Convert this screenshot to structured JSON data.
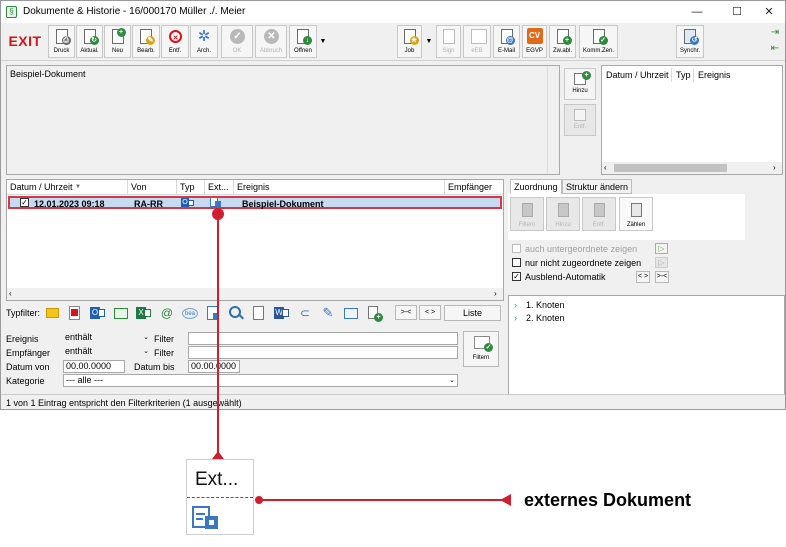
{
  "window": {
    "title": "Dokumente & Historie - 16/000170 Müller ./. Meier",
    "controls": {
      "minimize": "—",
      "maximize": "☐",
      "close": "✕"
    }
  },
  "toolbar": {
    "exit_label": "EXIT",
    "left_buttons": [
      {
        "label": "Druck",
        "icon": "print-doc-icon",
        "enabled": true
      },
      {
        "label": "Aktual.",
        "icon": "refresh-doc-icon",
        "enabled": true
      },
      {
        "label": "Neu",
        "icon": "new-doc-icon",
        "enabled": true
      },
      {
        "label": "Bearb.",
        "icon": "edit-doc-icon",
        "enabled": true
      },
      {
        "label": "Entf.",
        "icon": "delete-doc-icon",
        "enabled": true
      },
      {
        "label": "Arch.",
        "icon": "archive-icon",
        "enabled": true
      },
      {
        "label": "OK",
        "icon": "check-icon",
        "enabled": false
      },
      {
        "label": "Abbruch",
        "icon": "cancel-icon",
        "enabled": false
      },
      {
        "label": "Öffnen",
        "icon": "open-doc-icon",
        "enabled": true
      }
    ],
    "right_buttons": [
      {
        "label": "Job",
        "icon": "job-icon",
        "enabled": true
      },
      {
        "label": "Sign",
        "icon": "sign-icon",
        "enabled": false
      },
      {
        "label": "eEB",
        "icon": "eeb-icon",
        "enabled": false
      },
      {
        "label": "E-Mail",
        "icon": "email-icon",
        "enabled": true
      },
      {
        "label": "EGVP",
        "icon": "egvp-icon",
        "enabled": true
      },
      {
        "label": "Zw.abl.",
        "icon": "clipboard-icon",
        "enabled": true
      },
      {
        "label": "Komm.Zen.",
        "icon": "comm-center-icon",
        "enabled": true
      }
    ],
    "synchr_label": "Synchr."
  },
  "notes": {
    "text": "Beispiel-Dokument"
  },
  "history_side": {
    "hinzu_label": "Hinzu",
    "entf_label": "Entf.",
    "columns": [
      "Datum / Uhrzeit",
      "Typ",
      "Ereignis"
    ]
  },
  "grid": {
    "columns": [
      "Datum / Uhrzeit",
      "Von",
      "Typ",
      "Ext...",
      "Ereignis",
      "Empfänger"
    ],
    "sort_indicator": "▼",
    "rows": [
      {
        "checked": true,
        "datetime": "12.01.2023  09:18",
        "von": "RA-RR",
        "typ_icon": "outlook-type-icon",
        "ext_icon": "external-doc-icon",
        "ereignis": "Beispiel-Dokument",
        "empfaenger": ""
      }
    ]
  },
  "assignment": {
    "tabs": [
      "Zuordnung",
      "Struktur ändern"
    ],
    "buttons": [
      {
        "label": "Filtern",
        "enabled": false
      },
      {
        "label": "Hinzu",
        "enabled": false
      },
      {
        "label": "Entf.",
        "enabled": false
      },
      {
        "label": "Zählen",
        "enabled": true
      }
    ],
    "options": [
      {
        "label": "auch untergeordnete zeigen",
        "checked": false,
        "enabled": false
      },
      {
        "label": "nur nicht zugeordnete zeigen",
        "checked": false,
        "enabled": true
      },
      {
        "label": "Ausblend-Automatik",
        "checked": true,
        "enabled": true
      }
    ],
    "nav_labels": [
      "< >",
      ">-<"
    ]
  },
  "tree": {
    "items": [
      "1. Knoten",
      "2. Knoten"
    ],
    "expander": "›"
  },
  "typfilter": {
    "label": "Typfilter:",
    "icons": [
      "note-filter-icon",
      "pdf-filter-icon",
      "outlook-filter-icon",
      "folder-filter-icon",
      "excel-filter-icon",
      "at-filter-icon",
      "bea-filter-icon",
      "doc-filter-icon",
      "web-filter-icon",
      "text-filter-icon",
      "word-filter-icon",
      "attachment-filter-icon",
      "pen-filter-icon",
      "folder-open-filter-icon",
      "add-doc-filter-icon"
    ],
    "collapse_label": ">-<",
    "expand_label": "< >",
    "liste_label": "Liste"
  },
  "filter": {
    "ereignis_label": "Ereignis",
    "ereignis_mode": "enthält",
    "ereignis_filter_label": "Filter",
    "ereignis_value": "",
    "empfaenger_label": "Empfänger",
    "empfaenger_mode": "enthält",
    "empfaenger_filter_label": "Filter",
    "empfaenger_value": "",
    "datum_von_label": "Datum von",
    "datum_von_value": "00.00.0000",
    "datum_bis_label": "Datum bis",
    "datum_bis_value": "00.00.0000",
    "kategorie_label": "Kategorie",
    "kategorie_value": "--- alle ---",
    "filtern_label": "Filtern"
  },
  "status": {
    "text": "1 von 1 Eintrag entspricht den Filterkriterien (1 ausgewählt)"
  },
  "callout": {
    "zoom_header": "Ext...",
    "zoom_icon": "external-doc-icon",
    "text": "externes Dokument",
    "color": "#cf1f2f"
  },
  "colors": {
    "accent_red": "#d4141a",
    "selection": "#c4dbf2",
    "green": "#2e8b3d"
  }
}
